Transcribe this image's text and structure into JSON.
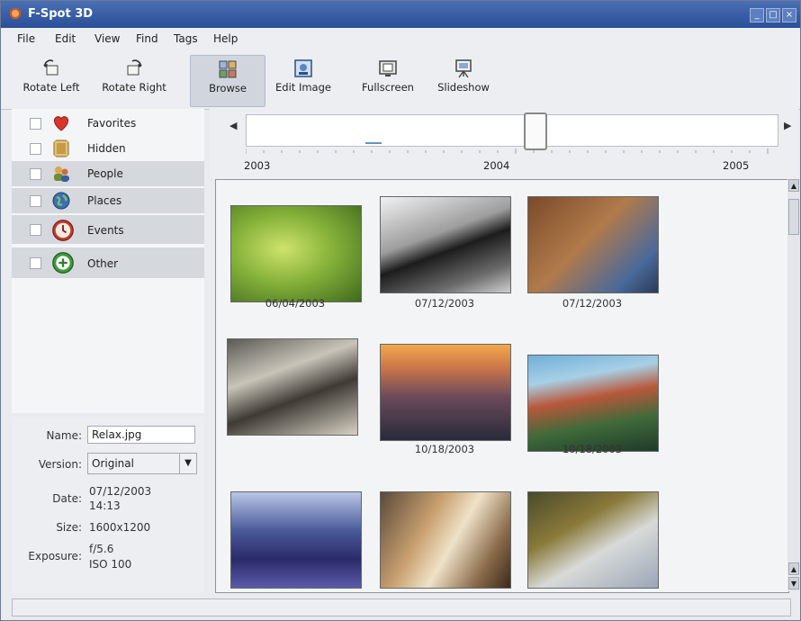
{
  "window": {
    "title": "F-Spot 3D"
  },
  "menu": [
    "File",
    "Edit",
    "View",
    "Find",
    "Tags",
    "Help"
  ],
  "toolbar": [
    {
      "label": "Rotate Left",
      "icon": "rotate-left-icon"
    },
    {
      "label": "Rotate Right",
      "icon": "rotate-right-icon"
    },
    {
      "label": "Browse",
      "icon": "browse-icon",
      "active": true
    },
    {
      "label": "Edit Image",
      "icon": "edit-image-icon"
    },
    {
      "label": "Fullscreen",
      "icon": "fullscreen-icon"
    },
    {
      "label": "Slideshow",
      "icon": "slideshow-icon"
    }
  ],
  "tags": [
    {
      "label": "Favorites",
      "icon": "heart-icon",
      "color": "#d9372b"
    },
    {
      "label": "Hidden",
      "icon": "hidden-icon",
      "color": "#d8b15a"
    },
    {
      "label": "People",
      "icon": "people-icon",
      "color": "#6b8e3a"
    },
    {
      "label": "Places",
      "icon": "globe-icon",
      "color": "#3a70b5"
    },
    {
      "label": "Events",
      "icon": "clock-icon",
      "color": "#c43b2e"
    },
    {
      "label": "Other",
      "icon": "other-icon",
      "color": "#3a9c3a"
    }
  ],
  "info": {
    "name_label": "Name:",
    "name_value": "Relax.jpg",
    "version_label": "Version:",
    "version_value": "Original",
    "date_label": "Date:",
    "date_value_1": "07/12/2003",
    "date_value_2": "14:13",
    "size_label": "Size:",
    "size_value": "1600x1200",
    "exposure_label": "Exposure:",
    "exposure_value_1": "f/5.6",
    "exposure_value_2": "ISO 100"
  },
  "timeline": {
    "years": [
      "2003",
      "2004",
      "2005"
    ]
  },
  "photos": [
    {
      "caption": "06/04/2003"
    },
    {
      "caption": "07/12/2003"
    },
    {
      "caption": "07/12/2003"
    },
    {
      "caption": ""
    },
    {
      "caption": "10/18/2003"
    },
    {
      "caption": "10/18/2003"
    },
    {
      "caption": ""
    },
    {
      "caption": ""
    },
    {
      "caption": ""
    }
  ]
}
